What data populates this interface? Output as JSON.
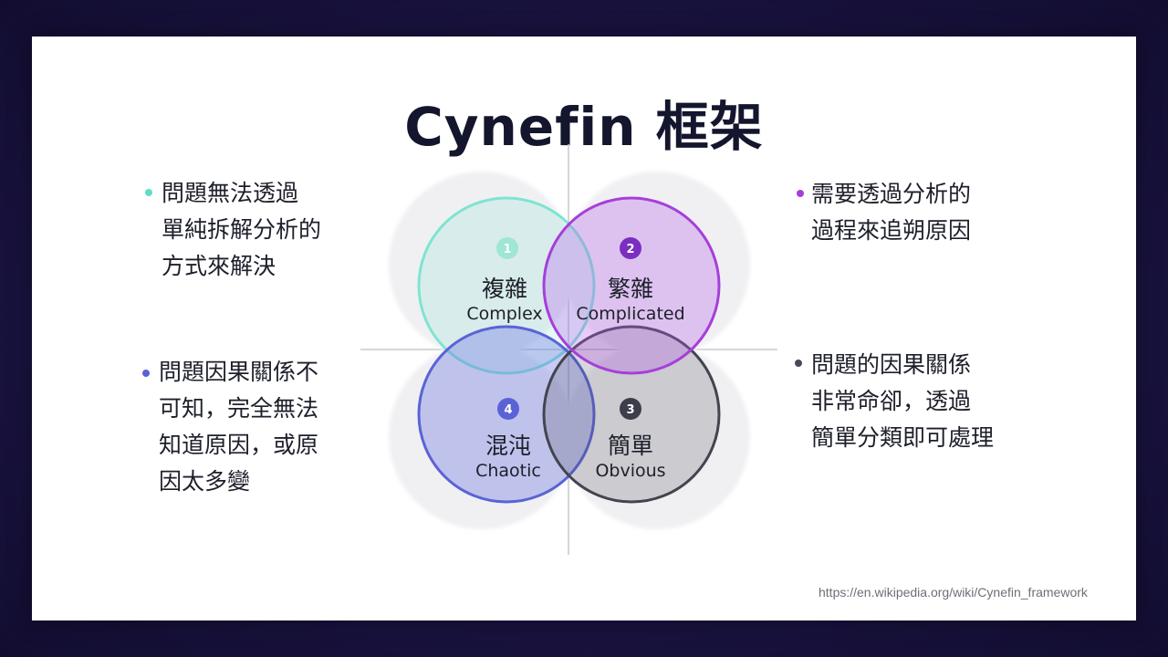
{
  "title": "Cynefin 框架",
  "quadrants": {
    "complex": {
      "num": "1",
      "zh": "複雜",
      "en": "Complex"
    },
    "complicated": {
      "num": "2",
      "zh": "繁雜",
      "en": "Complicated"
    },
    "chaotic": {
      "num": "4",
      "zh": "混沌",
      "en": "Chaotic"
    },
    "obvious": {
      "num": "3",
      "zh": "簡單",
      "en": "Obvious"
    }
  },
  "notes": {
    "complex": "問題無法透過\n單純拆解分析的\n方式來解決",
    "complicated": "需要透過分析的\n過程來追朔原因",
    "chaotic": "問題因果關係不\n可知，完全無法\n知道原因，或原\n因太多變",
    "obvious": "問題的因果關係\n非常命卻，透過\n簡單分類即可處理"
  },
  "credit": "https://en.wikipedia.org/wiki/Cynefin_framework",
  "colors": {
    "complex": "#62dcc6",
    "complicated": "#a63fd9",
    "chaotic": "#5a63d6",
    "obvious": "#4a4a56"
  }
}
